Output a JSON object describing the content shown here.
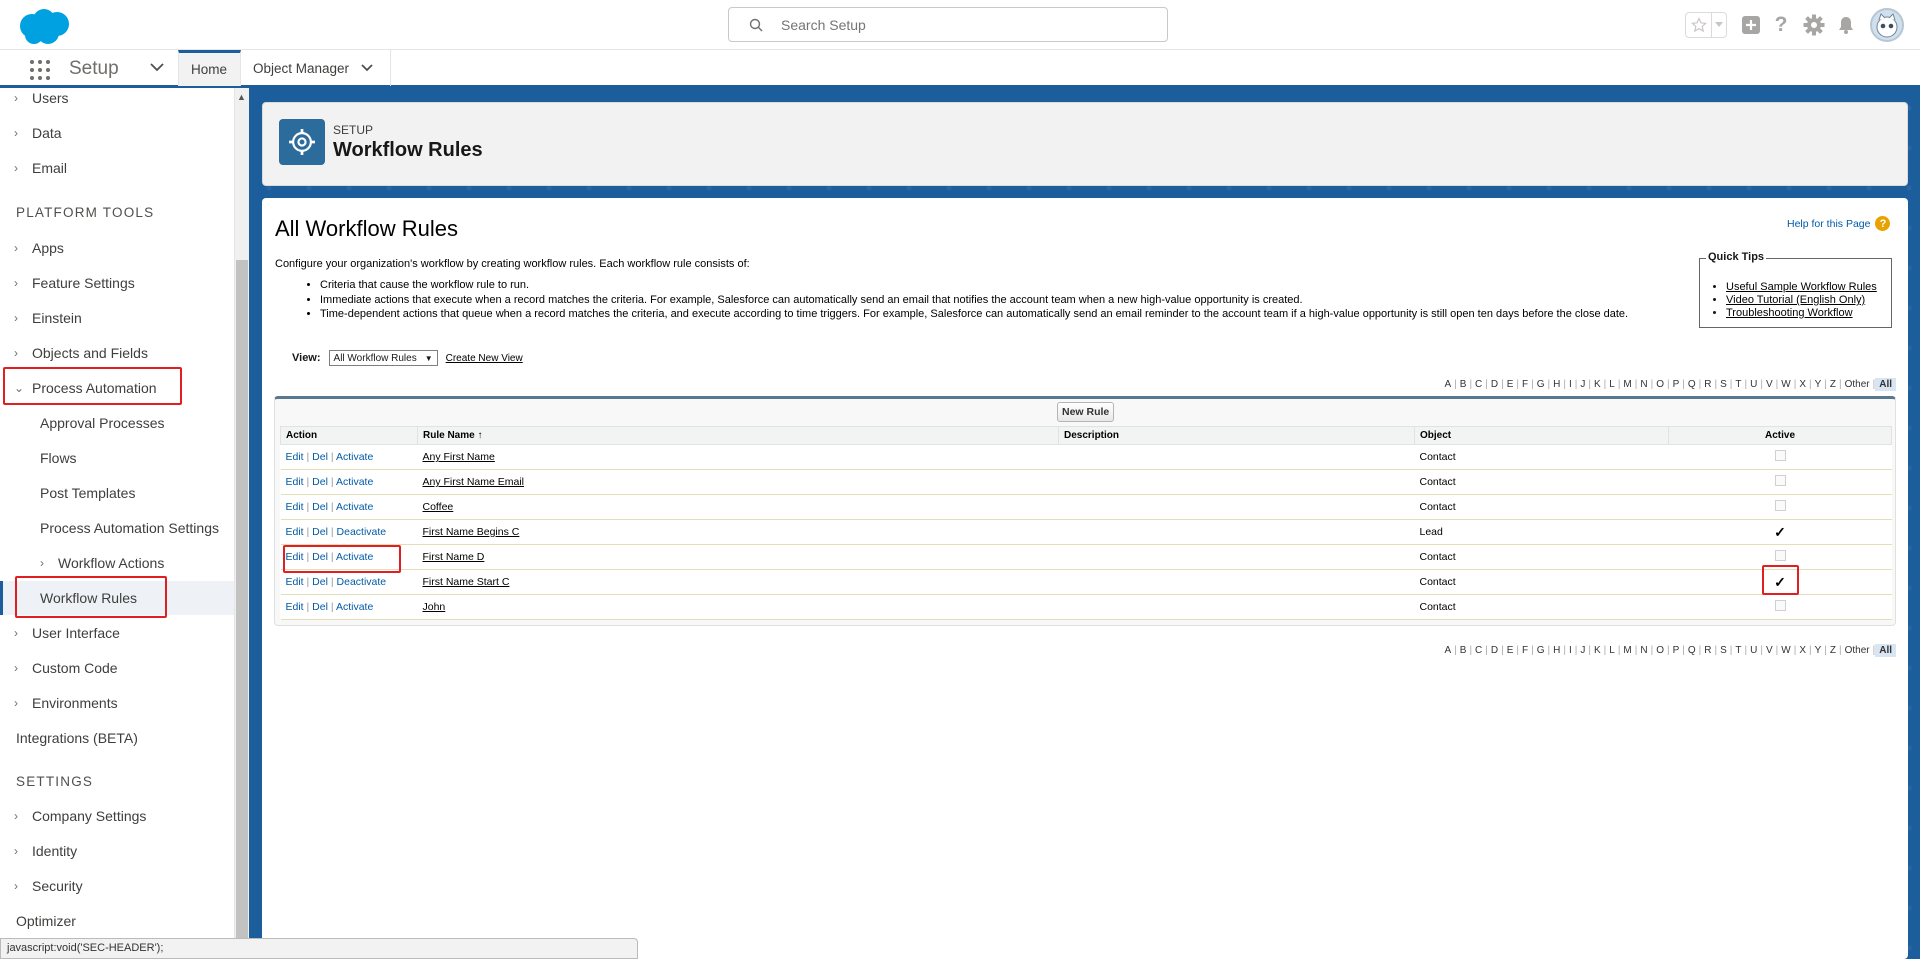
{
  "header": {
    "search_placeholder": "Search Setup"
  },
  "context_bar": {
    "app_name": "Setup",
    "tabs": [
      {
        "label": "Home"
      },
      {
        "label": "Object Manager"
      }
    ]
  },
  "sidebar": {
    "top_items": [
      "Users",
      "Data",
      "Email"
    ],
    "platform_tools_heading": "PLATFORM TOOLS",
    "platform_items": [
      "Apps",
      "Feature Settings",
      "Einstein",
      "Objects and Fields",
      "Process Automation"
    ],
    "process_automation_children": [
      "Approval Processes",
      "Flows",
      "Post Templates",
      "Process Automation Settings",
      "Workflow Actions",
      "Workflow Rules"
    ],
    "after_items": [
      "User Interface",
      "Custom Code",
      "Environments"
    ],
    "integrations": "Integrations (BETA)",
    "settings_heading": "SETTINGS",
    "settings_items": [
      "Company Settings",
      "Identity",
      "Security"
    ],
    "optimizer": "Optimizer"
  },
  "page_header": {
    "supertitle": "SETUP",
    "title": "Workflow Rules"
  },
  "page": {
    "title": "All Workflow Rules",
    "help_link": "Help for this Page",
    "intro": "Configure your organization's workflow by creating workflow rules. Each workflow rule consists of:",
    "bullets": [
      "Criteria that cause the workflow rule to run.",
      "Immediate actions that execute when a record matches the criteria. For example, Salesforce can automatically send an email that notifies the account team when a new high-value opportunity is created.",
      "Time-dependent actions that queue when a record matches the criteria, and execute according to time triggers. For example, Salesforce can automatically send an email reminder to the account team if a high-value opportunity is still open ten days before the close date."
    ],
    "quick_tips": {
      "title": "Quick Tips",
      "links": [
        "Useful Sample Workflow Rules",
        "Video Tutorial (English Only)",
        "Troubleshooting Workflow"
      ]
    },
    "view_label": "View:",
    "view_selected": "All Workflow Rules",
    "create_view": "Create New View",
    "alphabet": [
      "A",
      "B",
      "C",
      "D",
      "E",
      "F",
      "G",
      "H",
      "I",
      "J",
      "K",
      "L",
      "M",
      "N",
      "O",
      "P",
      "Q",
      "R",
      "S",
      "T",
      "U",
      "V",
      "W",
      "X",
      "Y",
      "Z",
      "Other",
      "All"
    ],
    "new_rule_button": "New Rule",
    "table": {
      "columns": [
        "Action",
        "Rule Name",
        "Description",
        "Object",
        "Active"
      ],
      "sort_indicator": "↑",
      "rows": [
        {
          "edit": "Edit",
          "del": "Del",
          "toggle": "Activate",
          "name": "Any First Name",
          "description": "",
          "object": "Contact",
          "active": false
        },
        {
          "edit": "Edit",
          "del": "Del",
          "toggle": "Activate",
          "name": "Any First Name Email",
          "description": "",
          "object": "Contact",
          "active": false
        },
        {
          "edit": "Edit",
          "del": "Del",
          "toggle": "Activate",
          "name": "Coffee",
          "description": "",
          "object": "Contact",
          "active": false
        },
        {
          "edit": "Edit",
          "del": "Del",
          "toggle": "Deactivate",
          "name": "First Name Begins C",
          "description": "",
          "object": "Lead",
          "active": true
        },
        {
          "edit": "Edit",
          "del": "Del",
          "toggle": "Activate",
          "name": "First Name D",
          "description": "",
          "object": "Contact",
          "active": false
        },
        {
          "edit": "Edit",
          "del": "Del",
          "toggle": "Deactivate",
          "name": "First Name Start C",
          "description": "",
          "object": "Contact",
          "active": true
        },
        {
          "edit": "Edit",
          "del": "Del",
          "toggle": "Activate",
          "name": "John",
          "description": "",
          "object": "Contact",
          "active": false
        }
      ]
    }
  },
  "status_bar": "javascript:void('SEC-HEADER');",
  "colors": {
    "brand_blue": "#1b5e9b",
    "link_blue": "#015ba7",
    "highlight_red": "#e02020"
  }
}
